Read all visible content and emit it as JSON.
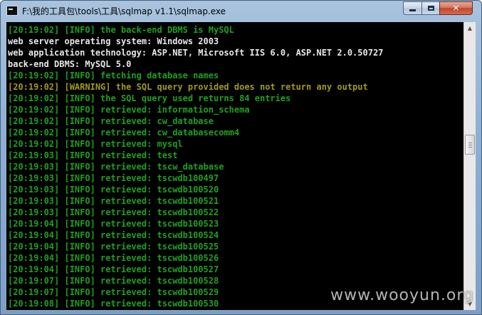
{
  "window": {
    "title": "F:\\我的工具包\\tools\\工具\\sqlmap v1.1\\sqlmap.exe",
    "min_label": "",
    "max_label": "",
    "close_label": "✕"
  },
  "console": {
    "lines": [
      {
        "text": "[20:19:02] [INFO] the back-end DBMS is MySQL",
        "kind": "info"
      },
      {
        "text": "web server operating system: Windows 2003",
        "kind": "plain"
      },
      {
        "text": "web application technology: ASP.NET, Microsoft IIS 6.0, ASP.NET 2.0.50727",
        "kind": "plain"
      },
      {
        "text": "back-end DBMS: MySQL 5.0",
        "kind": "plain"
      },
      {
        "text": "[20:19:02] [INFO] fetching database names",
        "kind": "info"
      },
      {
        "text": "[20:19:02] [WARNING] the SQL query provided does not return any output",
        "kind": "warning"
      },
      {
        "text": "[20:19:02] [INFO] the SQL query used returns 84 entries",
        "kind": "info"
      },
      {
        "text": "[20:19:02] [INFO] retrieved: information_schema",
        "kind": "info"
      },
      {
        "text": "[20:19:02] [INFO] retrieved: cw_database",
        "kind": "info"
      },
      {
        "text": "[20:19:02] [INFO] retrieved: cw_databasecomm4",
        "kind": "info"
      },
      {
        "text": "[20:19:02] [INFO] retrieved: mysql",
        "kind": "info"
      },
      {
        "text": "[20:19:03] [INFO] retrieved: test",
        "kind": "info"
      },
      {
        "text": "[20:19:03] [INFO] retrieved: tscw_database",
        "kind": "info"
      },
      {
        "text": "[20:19:03] [INFO] retrieved: tscwdb100497",
        "kind": "info"
      },
      {
        "text": "[20:19:03] [INFO] retrieved: tscwdb100520",
        "kind": "info"
      },
      {
        "text": "[20:19:03] [INFO] retrieved: tscwdb100521",
        "kind": "info"
      },
      {
        "text": "[20:19:03] [INFO] retrieved: tscwdb100522",
        "kind": "info"
      },
      {
        "text": "[20:19:04] [INFO] retrieved: tscwdb100523",
        "kind": "info"
      },
      {
        "text": "[20:19:04] [INFO] retrieved: tscwdb100524",
        "kind": "info"
      },
      {
        "text": "[20:19:04] [INFO] retrieved: tscwdb100525",
        "kind": "info"
      },
      {
        "text": "[20:19:04] [INFO] retrieved: tscwdb100526",
        "kind": "info"
      },
      {
        "text": "[20:19:04] [INFO] retrieved: tscwdb100527",
        "kind": "info"
      },
      {
        "text": "[20:19:07] [INFO] retrieved: tscwdb100528",
        "kind": "info"
      },
      {
        "text": "[20:19:07] [INFO] retrieved: tscwdb100529",
        "kind": "info"
      },
      {
        "text": "[20:19:08] [INFO] retrieved: tscwdb100530",
        "kind": "info"
      }
    ]
  },
  "watermark": "www.wooyun.org",
  "colors": {
    "info": "#1fa01f",
    "warning": "#a09a20",
    "plain": "#e8e8e8",
    "background": "#000000"
  },
  "icons": {
    "app": "console-app-icon",
    "minimize": "minimize-icon",
    "maximize": "maximize-icon",
    "close": "close-icon",
    "scroll_up": "scroll-up-arrow-icon",
    "scroll_down": "scroll-down-arrow-icon"
  }
}
